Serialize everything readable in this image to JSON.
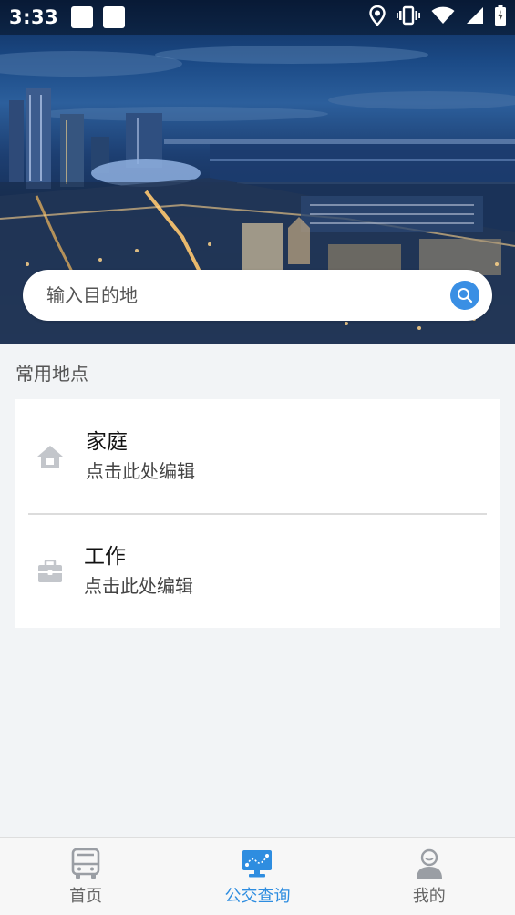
{
  "status_bar": {
    "time": "3:33"
  },
  "search": {
    "placeholder": "输入目的地"
  },
  "common_places": {
    "title": "常用地点",
    "items": [
      {
        "name": "家庭",
        "hint": "点击此处编辑",
        "icon": "home-icon"
      },
      {
        "name": "工作",
        "hint": "点击此处编辑",
        "icon": "briefcase-icon"
      }
    ]
  },
  "bottom_nav": {
    "items": [
      {
        "label": "首页",
        "icon": "bus-icon",
        "active": false
      },
      {
        "label": "公交查询",
        "icon": "monitor-map-icon",
        "active": true
      },
      {
        "label": "我的",
        "icon": "user-icon",
        "active": false
      }
    ]
  },
  "colors": {
    "accent": "#2e8de0",
    "search_button": "#3a8fe4",
    "inactive_icon": "#9a9ea4",
    "background": "#f2f4f6"
  }
}
